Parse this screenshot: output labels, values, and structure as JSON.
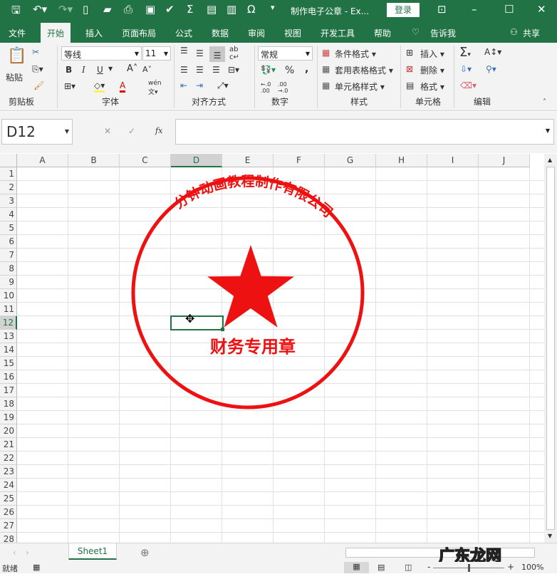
{
  "title": "制作电子公章 - Ex...",
  "login": "登录",
  "menu": [
    "文件",
    "开始",
    "插入",
    "页面布局",
    "公式",
    "数据",
    "审阅",
    "视图",
    "开发工具",
    "帮助",
    "告诉我"
  ],
  "share": "共享",
  "ribbon": {
    "paste": "粘贴",
    "font_name": "等线",
    "font_size": "11",
    "number_format": "常规",
    "cond_format": "条件格式",
    "table_format": "套用表格格式",
    "cell_style": "单元格样式",
    "insert": "插入",
    "delete": "删除",
    "format": "格式",
    "bold": "B",
    "italic": "I",
    "underline": "U",
    "percent": "%",
    "comma": ",",
    "groups": [
      "剪贴板",
      "字体",
      "对齐方式",
      "数字",
      "样式",
      "单元格",
      "编辑"
    ]
  },
  "namebox": "D12",
  "fx": "fx",
  "columns": [
    "A",
    "B",
    "C",
    "D",
    "E",
    "F",
    "G",
    "H",
    "I",
    "J"
  ],
  "rows": [
    "1",
    "2",
    "3",
    "4",
    "5",
    "6",
    "7",
    "8",
    "9",
    "10",
    "11",
    "12",
    "13",
    "14",
    "15",
    "16",
    "17",
    "18",
    "19",
    "20",
    "21",
    "22",
    "23",
    "24",
    "25",
    "26",
    "27",
    "28"
  ],
  "stamp": {
    "company": "一分钟动画教程制作有限公司",
    "label": "财务专用章",
    "color": "#ee1111"
  },
  "sheet_tab": "Sheet1",
  "status": "就绪",
  "zoom": "100%",
  "watermark": "广东龙网"
}
